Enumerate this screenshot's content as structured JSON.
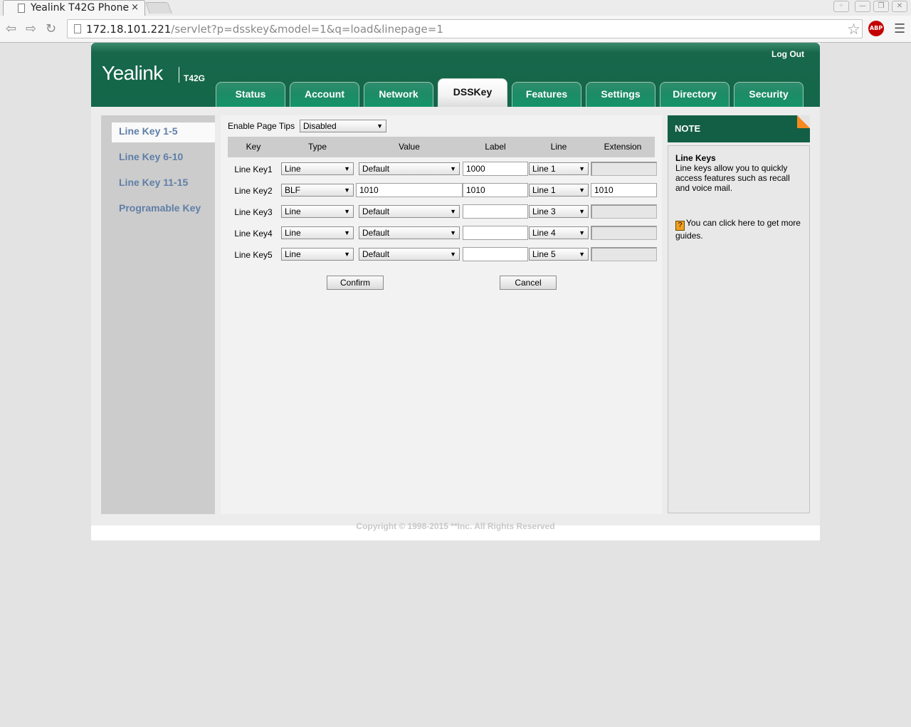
{
  "browser": {
    "tab_title": "Yealink T42G Phone",
    "tab_close": "×",
    "url_host": "172.18.101.221",
    "url_path": "/servlet?p=dsskey&model=1&q=load&linepage=1",
    "abp_label": "ABP"
  },
  "header": {
    "logout": "Log Out",
    "logo": "Yealink",
    "model": "T42G",
    "tabs": [
      "Status",
      "Account",
      "Network",
      "DSSKey",
      "Features",
      "Settings",
      "Directory",
      "Security"
    ],
    "active_tab": "DSSKey"
  },
  "sidebar": {
    "items": [
      "Line Key 1-5",
      "Line Key 6-10",
      "Line Key 11-15",
      "Programable Key"
    ],
    "active": "Line Key 1-5"
  },
  "main": {
    "page_tips_label": "Enable Page Tips",
    "page_tips_value": "Disabled",
    "columns": [
      "Key",
      "Type",
      "Value",
      "Label",
      "Line",
      "Extension"
    ],
    "rows": [
      {
        "key": "Line Key1",
        "type": "Line",
        "value": "Default",
        "value_kind": "select",
        "label": "1000",
        "line": "Line 1",
        "extension": "",
        "extension_enabled": false
      },
      {
        "key": "Line Key2",
        "type": "BLF",
        "value": "1010",
        "value_kind": "input",
        "label": "1010",
        "line": "Line 1",
        "extension": "1010",
        "extension_enabled": true
      },
      {
        "key": "Line Key3",
        "type": "Line",
        "value": "Default",
        "value_kind": "select",
        "label": "",
        "line": "Line 3",
        "extension": "",
        "extension_enabled": false
      },
      {
        "key": "Line Key4",
        "type": "Line",
        "value": "Default",
        "value_kind": "select",
        "label": "",
        "line": "Line 4",
        "extension": "",
        "extension_enabled": false
      },
      {
        "key": "Line Key5",
        "type": "Line",
        "value": "Default",
        "value_kind": "select",
        "label": "",
        "line": "Line 5",
        "extension": "",
        "extension_enabled": false
      }
    ],
    "confirm": "Confirm",
    "cancel": "Cancel"
  },
  "note": {
    "title": "NOTE",
    "heading": "Line Keys",
    "text": "Line keys allow you to quickly access features such as recall and voice mail.",
    "guide": "You can click here to get more guides.",
    "guide_icon": "?"
  },
  "footer": {
    "copyright": "Copyright © 1998-2015 **Inc. All Rights Reserved"
  }
}
